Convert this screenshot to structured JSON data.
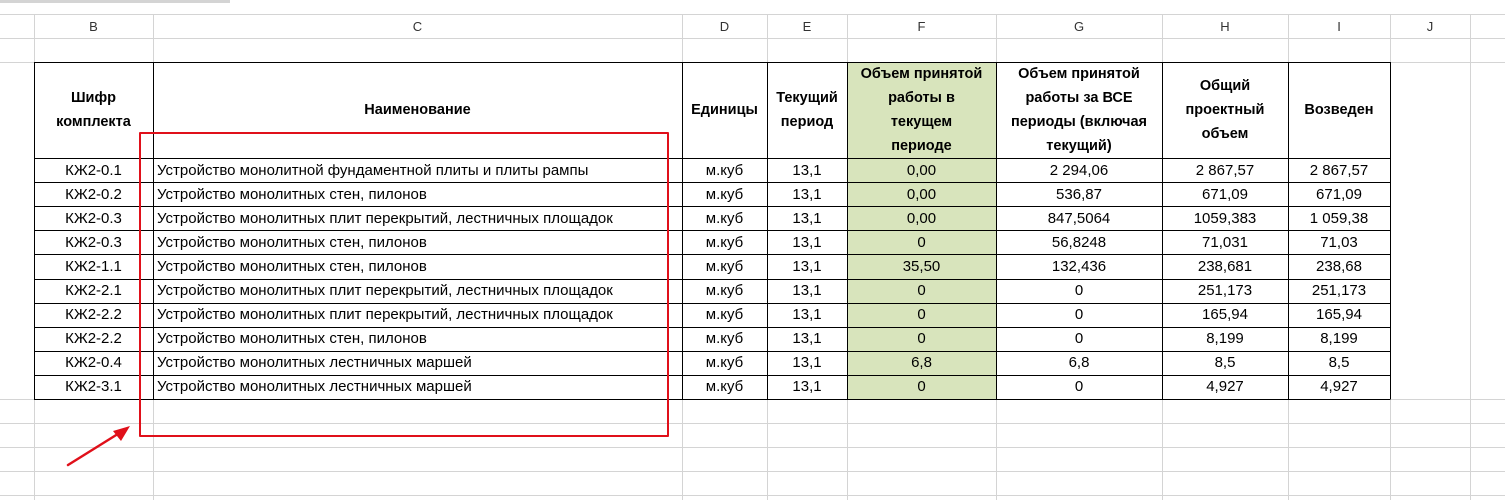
{
  "columns": [
    "B",
    "C",
    "D",
    "E",
    "F",
    "G",
    "H",
    "I",
    "J"
  ],
  "headers": {
    "B": "Шифр\nкомплекта",
    "C": "Наименование",
    "D": "Единицы",
    "E": "Текущий\nпериод",
    "F": "Объем принятой\nработы в\nтекущем\nпериоде",
    "G": "Объем принятой\nработы за ВСЕ\nпериоды (включая\nтекущий)",
    "H": "Общий\nпроектный\nобъем",
    "I": "Возведен"
  },
  "rows": [
    [
      "КЖ2-0.1",
      "Устройство монолитной фундаментной плиты и плиты рампы",
      "м.куб",
      "13,1",
      "0,00",
      "2 294,06",
      "2 867,57",
      "2 867,57"
    ],
    [
      "КЖ2-0.2",
      "Устройство монолитных стен, пилонов",
      "м.куб",
      "13,1",
      "0,00",
      "536,87",
      "671,09",
      "671,09"
    ],
    [
      "КЖ2-0.3",
      "Устройство монолитных плит перекрытий, лестничных площадок",
      "м.куб",
      "13,1",
      "0,00",
      "847,5064",
      "1059,383",
      "1 059,38"
    ],
    [
      "КЖ2-0.3",
      "Устройство монолитных стен, пилонов",
      "м.куб",
      "13,1",
      "0",
      "56,8248",
      "71,031",
      "71,03"
    ],
    [
      "КЖ2-1.1",
      "Устройство монолитных стен, пилонов",
      "м.куб",
      "13,1",
      "35,50",
      "132,436",
      "238,681",
      "238,68"
    ],
    [
      "КЖ2-2.1",
      "Устройство монолитных плит перекрытий, лестничных площадок",
      "м.куб",
      "13,1",
      "0",
      "0",
      "251,173",
      "251,173"
    ],
    [
      "КЖ2-2.2",
      "Устройство монолитных плит перекрытий, лестничных площадок",
      "м.куб",
      "13,1",
      "0",
      "0",
      "165,94",
      "165,94"
    ],
    [
      "КЖ2-2.2",
      "Устройство монолитных стен, пилонов",
      "м.куб",
      "13,1",
      "0",
      "0",
      "8,199",
      "8,199"
    ],
    [
      "КЖ2-0.4",
      "Устройство монолитных лестничных маршей",
      "м.куб",
      "13,1",
      "6,8",
      "6,8",
      "8,5",
      "8,5"
    ],
    [
      "КЖ2-3.1",
      "Устройство монолитных лестничных маршей",
      "м.куб",
      "13,1",
      "0",
      "0",
      "4,927",
      "4,927"
    ]
  ],
  "colors": {
    "highlight_fill": "#d8e4bc",
    "annotation_red": "#e0101a",
    "gridline": "#d4d4d4",
    "border": "#000000"
  }
}
